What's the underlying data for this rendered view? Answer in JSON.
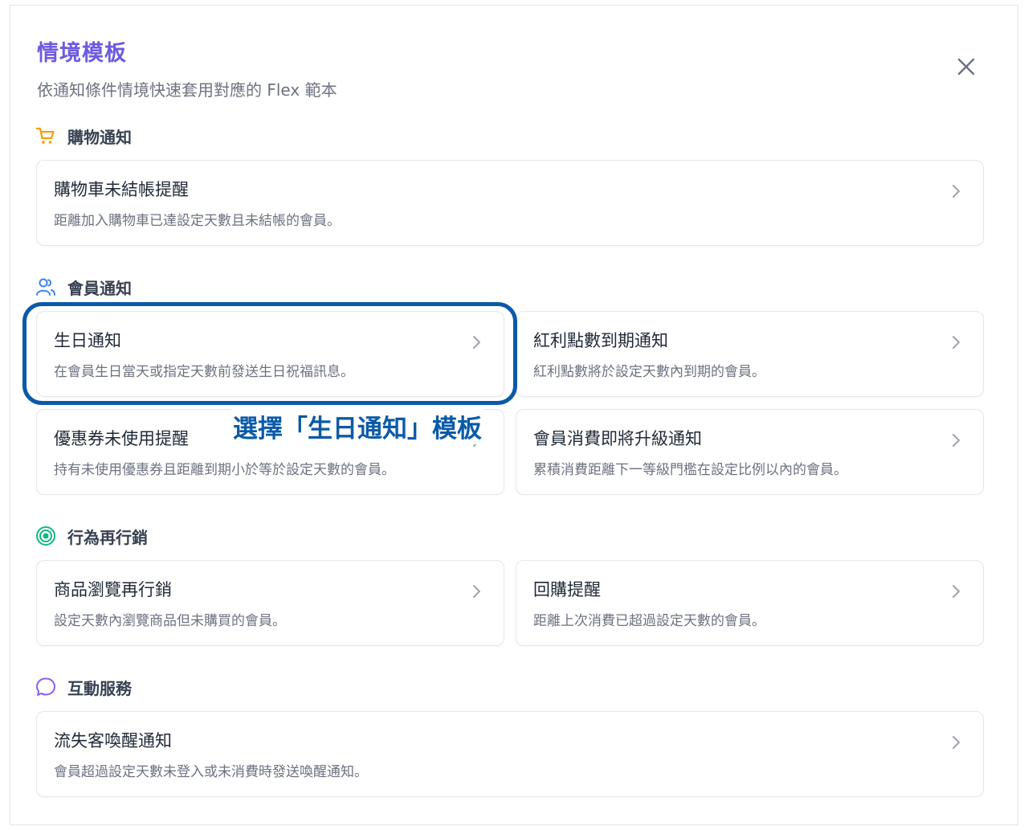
{
  "header": {
    "title": "情境模板",
    "subtitle": "依通知條件情境快速套用對應的 Flex 範本"
  },
  "colors": {
    "title": "#6d5ae0",
    "shopping_icon": "#f59e0b",
    "member_icon": "#3b82f6",
    "remarketing_icon": "#10b981",
    "interaction_icon": "#8b5cf6",
    "highlight": "#0b5aa8"
  },
  "sections": [
    {
      "label": "購物通知",
      "icon": "shopping-cart-icon",
      "cards": [
        {
          "title": "購物車未結帳提醒",
          "desc": "距離加入購物車已達設定天數且未結帳的會員。"
        }
      ]
    },
    {
      "label": "會員通知",
      "icon": "users-icon",
      "cards": [
        {
          "title": "生日通知",
          "desc": "在會員生日當天或指定天數前發送生日祝福訊息。"
        },
        {
          "title": "紅利點數到期通知",
          "desc": "紅利點數將於設定天數內到期的會員。"
        },
        {
          "title": "優惠券未使用提醒",
          "desc": "持有未使用優惠券且距離到期小於等於設定天數的會員。"
        },
        {
          "title": "會員消費即將升級通知",
          "desc": "累積消費距離下一等級門檻在設定比例以內的會員。"
        }
      ]
    },
    {
      "label": "行為再行銷",
      "icon": "target-icon",
      "cards": [
        {
          "title": "商品瀏覽再行銷",
          "desc": "設定天數內瀏覽商品但未購買的會員。"
        },
        {
          "title": "回購提醒",
          "desc": "距離上次消費已超過設定天數的會員。"
        }
      ]
    },
    {
      "label": "互動服務",
      "icon": "chat-bubble-icon",
      "cards": [
        {
          "title": "流失客喚醒通知",
          "desc": "會員超過設定天數未登入或未消費時發送喚醒通知。"
        }
      ]
    }
  ],
  "annotation": {
    "text": "選擇「生日通知」模板"
  }
}
